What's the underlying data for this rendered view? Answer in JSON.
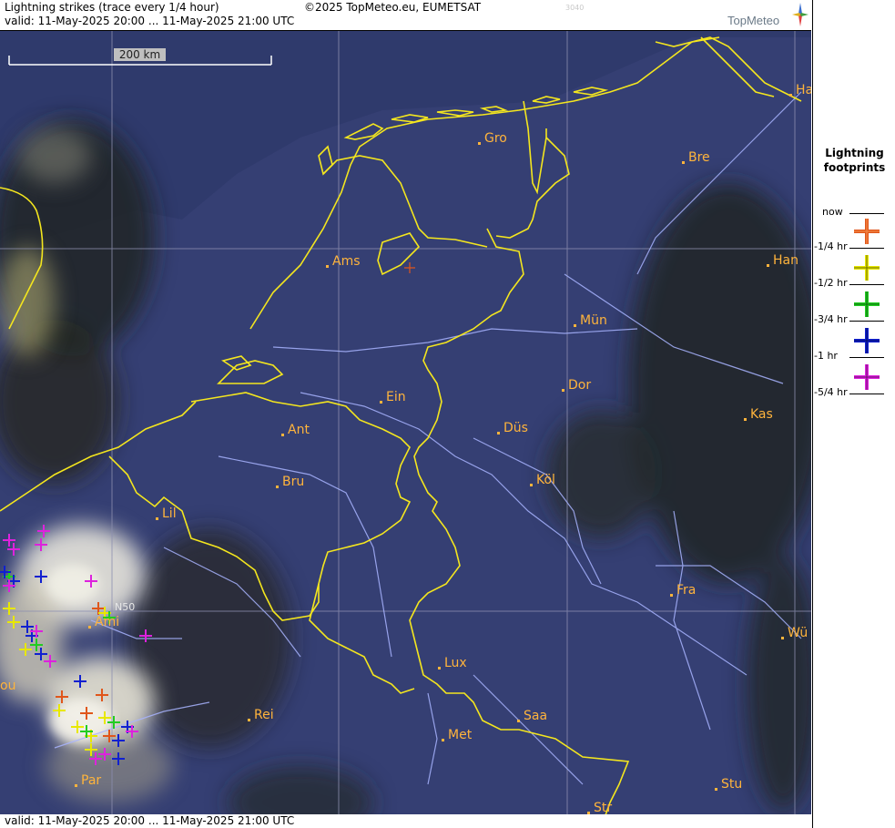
{
  "header": {
    "title": "Lightning strikes (trace every 1/4 hour)",
    "copyright": "©2025 TopMeteo.eu, EUMETSAT",
    "code": "3040",
    "valid": "valid:  11-May-2025 20:00 ... 11-May-2025 21:00 UTC",
    "logo": "TopMeteo"
  },
  "map": {
    "scale_label": "200 km",
    "gridline_label": "N50",
    "cities": [
      {
        "id": "ha",
        "label": "Ha"
      },
      {
        "id": "gro",
        "label": "Gro"
      },
      {
        "id": "bre",
        "label": "Bre"
      },
      {
        "id": "ams",
        "label": "Ams"
      },
      {
        "id": "han",
        "label": "Han"
      },
      {
        "id": "mun",
        "label": "Mün"
      },
      {
        "id": "dor",
        "label": "Dor"
      },
      {
        "id": "ein",
        "label": "Ein"
      },
      {
        "id": "kas",
        "label": "Kas"
      },
      {
        "id": "ant",
        "label": "Ant"
      },
      {
        "id": "dus",
        "label": "Düs"
      },
      {
        "id": "kol",
        "label": "Köl"
      },
      {
        "id": "bru",
        "label": "Bru"
      },
      {
        "id": "lil",
        "label": "Lil"
      },
      {
        "id": "fra",
        "label": "Fra"
      },
      {
        "id": "ami",
        "label": "Ami"
      },
      {
        "id": "wu",
        "label": "Wü"
      },
      {
        "id": "lux",
        "label": "Lux"
      },
      {
        "id": "ou",
        "label": "ou"
      },
      {
        "id": "rei",
        "label": "Rei"
      },
      {
        "id": "saa",
        "label": "Saa"
      },
      {
        "id": "met",
        "label": "Met"
      },
      {
        "id": "par",
        "label": "Par"
      },
      {
        "id": "stu",
        "label": "Stu"
      },
      {
        "id": "str",
        "label": "Str"
      }
    ]
  },
  "footer": {
    "valid": "valid:  11-May-2025 20:00 ... 11-May-2025 21:00 UTC"
  },
  "legend": {
    "title_line1": "Lightning",
    "title_line2": "footprints",
    "rows": [
      {
        "label": "now",
        "color": "#e0561b"
      },
      {
        "label": "-1/4 hr",
        "color": "#e8e800"
      },
      {
        "label": "-1/2 hr",
        "color": "#22cc22"
      },
      {
        "label": "-3/4 hr",
        "color": "#1020d0"
      },
      {
        "label": "-1 hr",
        "color": "#dd22dd"
      },
      {
        "label": "-5/4 hr",
        "color": ""
      }
    ]
  },
  "colors": {
    "border": "#f4e61e",
    "river": "#a8b4ff",
    "city": "#ffb43c",
    "sea": "#2f3a6c",
    "land": "#383f70"
  }
}
